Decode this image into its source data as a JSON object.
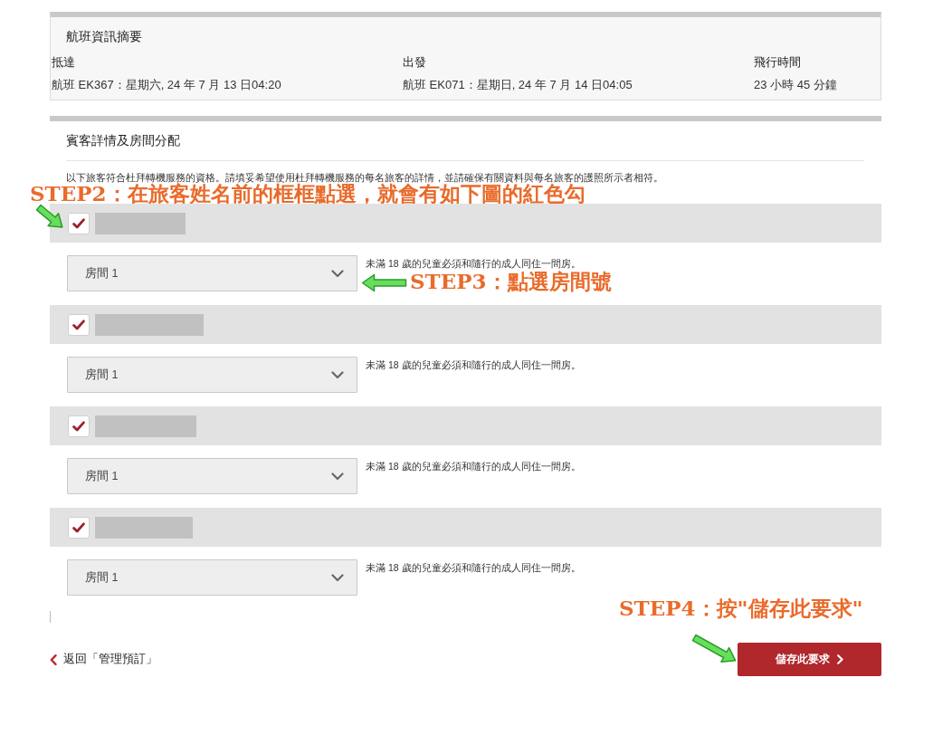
{
  "flight_summary": {
    "title": "航班資訊摘要",
    "columns": [
      {
        "label": "抵達",
        "value": "航班 EK367：星期六, 24 年 7 月 13 日04:20"
      },
      {
        "label": "出發",
        "value": "航班 EK071：星期日, 24 年 7 月 14 日04:05"
      },
      {
        "label": "飛行時間",
        "value": "23 小時 45 分鐘"
      }
    ]
  },
  "guest_section": {
    "title": "賓客詳情及房間分配",
    "description": "以下旅客符合杜拜轉機服務的資格。請填妥希望使用杜拜轉機服務的每名旅客的詳情，並請確保有關資料與每名旅客的護照所示者相符。",
    "step_note": "STEP2：在旅客姓名前的框框點選，就會有如下圖的紅色勾",
    "guests": [
      {
        "checked": true,
        "room": "房間 1",
        "room_note": "STEP3：點選房間號",
        "notice": "未滿 18 歲的兒童必須和隨行的成人同住一間房。"
      },
      {
        "checked": true,
        "room": "房間 1",
        "notice": "未滿 18 歲的兒童必須和隨行的成人同住一間房。"
      },
      {
        "checked": true,
        "room": "房間 1",
        "notice": "未滿 18 歲的兒童必須和隨行的成人同住一間房。"
      },
      {
        "checked": true,
        "room": "房間 1",
        "notice": "未滿 18 歲的兒童必須和隨行的成人同住一間房。"
      }
    ]
  },
  "footer": {
    "back_link": "返回「管理預訂」",
    "save_button": "儲存此要求",
    "step_note": "STEP4：按\"儲存此要求\""
  }
}
